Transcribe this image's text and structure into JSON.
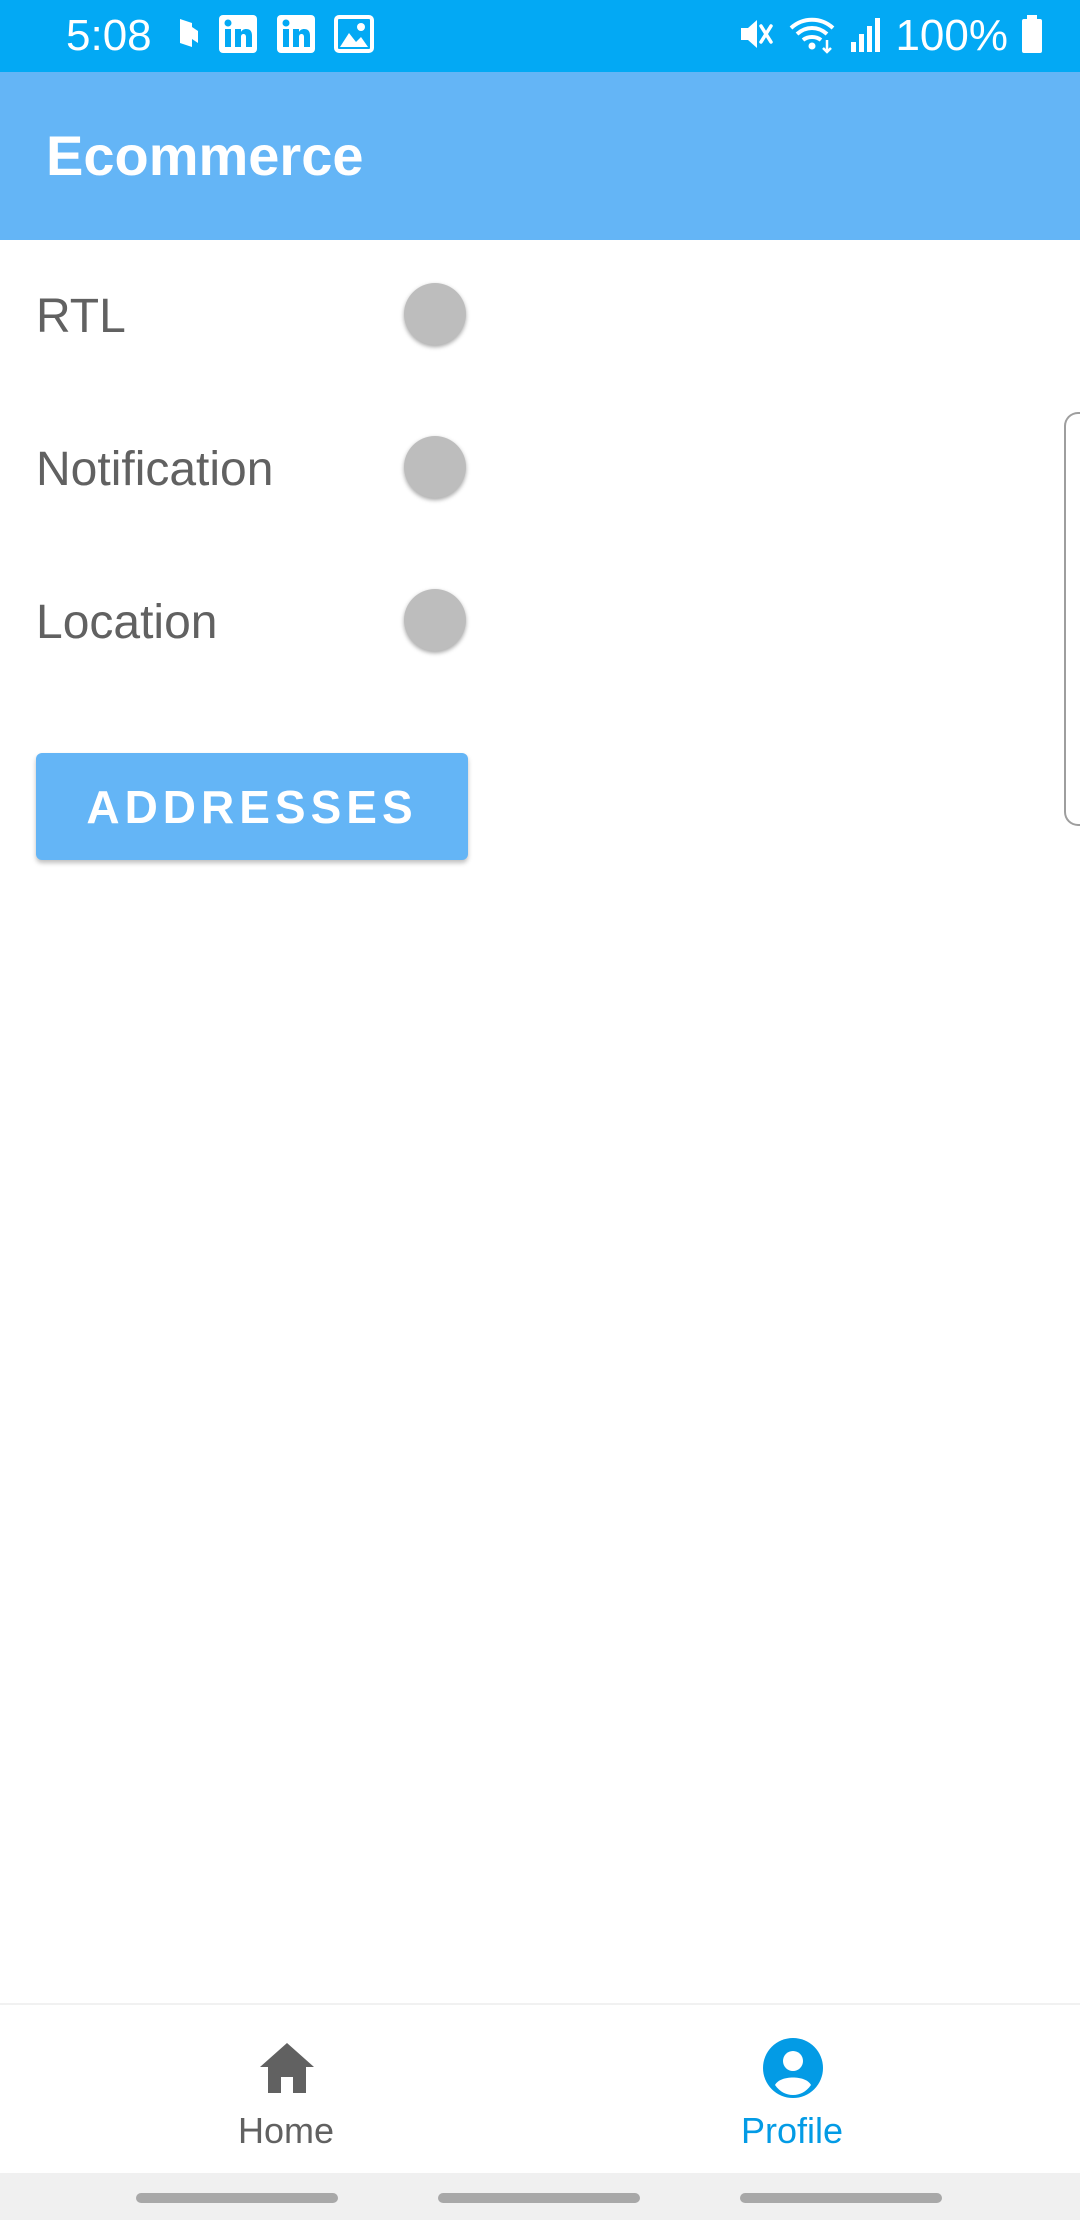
{
  "status_bar": {
    "time": "5:08",
    "battery": "100%",
    "left_icons": [
      "notification-app-icon",
      "linkedin-icon",
      "linkedin-icon",
      "image-icon"
    ],
    "right_icons": [
      "mute-icon",
      "wifi-icon",
      "signal-icon",
      "battery-icon"
    ],
    "background": "#03a9f4"
  },
  "app_bar": {
    "title": "Ecommerce",
    "background": "#64b5f6"
  },
  "settings": {
    "rtl_label": "RTL",
    "notification_label": "Notification",
    "location_label": "Location",
    "rtl_enabled": false,
    "notification_enabled": false,
    "location_enabled": false
  },
  "addresses_button": {
    "label": "ADDRESSES"
  },
  "bottom_nav": {
    "home_label": "Home",
    "profile_label": "Profile",
    "selected": "Profile",
    "active_color": "#039be5",
    "inactive_color": "#616161"
  }
}
